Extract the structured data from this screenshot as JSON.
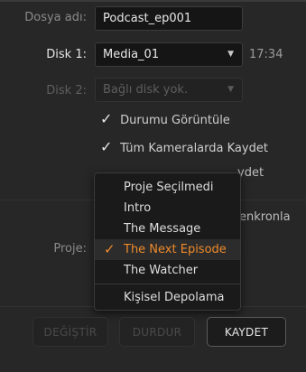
{
  "form": {
    "filename_label": "Dosya adı:",
    "filename_value": "Podcast_ep001",
    "disk1_label": "Disk 1:",
    "disk1_value": "Media_01",
    "disk1_time": "17:34",
    "disk2_label": "Disk 2:",
    "disk2_value": "Bağlı disk yok.",
    "project_label": "Proje:"
  },
  "options": {
    "show_status": "Durumu Görüntüle",
    "record_all_cameras": "Tüm Kameralarda Kaydet",
    "partial_row_tail": "ydet",
    "sync_tail": "enkronla"
  },
  "project_menu": {
    "items": [
      {
        "label": "Proje Seçilmedi",
        "selected": false
      },
      {
        "label": "Intro",
        "selected": false
      },
      {
        "label": "The Message",
        "selected": false
      },
      {
        "label": "The Next Episode",
        "selected": true
      },
      {
        "label": "The Watcher",
        "selected": false
      }
    ],
    "personal_storage": "Kişisel Depolama",
    "check_glyph": "✓"
  },
  "buttons": {
    "change": "DEĞİŞTİR",
    "stop": "DURDUR",
    "record": "KAYDET"
  },
  "colors": {
    "accent": "#ee8a2a",
    "background": "#272727"
  }
}
